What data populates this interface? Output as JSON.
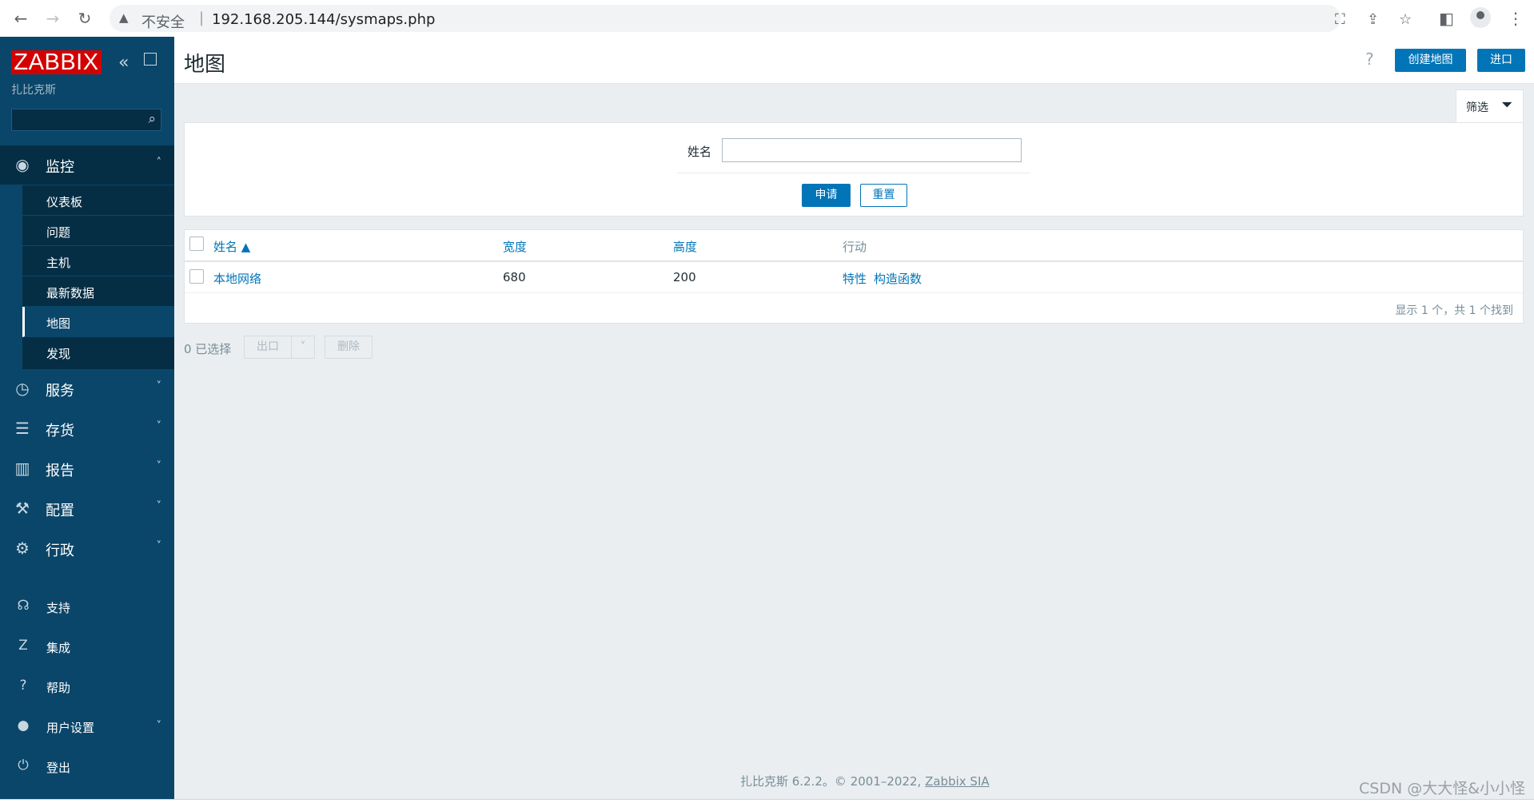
{
  "browser": {
    "insecure_label": "不安全",
    "separator": "|",
    "url": "192.168.205.144/sysmaps.php"
  },
  "sidebar": {
    "logo": "ZABBIX",
    "server_name": "扎比克斯",
    "search_placeholder": "",
    "monitor": {
      "label": "监控",
      "items": [
        "仪表板",
        "问题",
        "主机",
        "最新数据",
        "地图",
        "发现"
      ],
      "active_index": 4
    },
    "sections": [
      "服务",
      "存货",
      "报告",
      "配置",
      "行政"
    ],
    "bottom": {
      "support": "支持",
      "integrations": "集成",
      "help": "帮助",
      "user_settings": "用户设置",
      "logout": "登出"
    }
  },
  "header": {
    "title": "地图",
    "help": "?",
    "create_label": "创建地图",
    "import_label": "进口"
  },
  "filter": {
    "tab_label": "筛选",
    "name_label": "姓名",
    "name_value": "",
    "apply_label": "申请",
    "reset_label": "重置"
  },
  "table": {
    "columns": {
      "name": "姓名 ▲",
      "width": "宽度",
      "height": "高度",
      "actions": "行动"
    },
    "rows": [
      {
        "name": "本地网络",
        "width": "680",
        "height": "200",
        "action_props": "特性",
        "action_ctor": "构造函数"
      }
    ],
    "footer": "显示 1 个，共 1 个找到"
  },
  "mass_actions": {
    "selected": "0 已选择",
    "export_label": "出口",
    "delete_label": "删除"
  },
  "footer": {
    "text": "扎比克斯 6.2.2。© 2001–2022, ",
    "link": "Zabbix SIA"
  },
  "watermark": "CSDN @大大怪&小小怪",
  "colors": {
    "sidebar": "#0a466a",
    "accent": "#0275b8",
    "logo": "#d40000"
  }
}
